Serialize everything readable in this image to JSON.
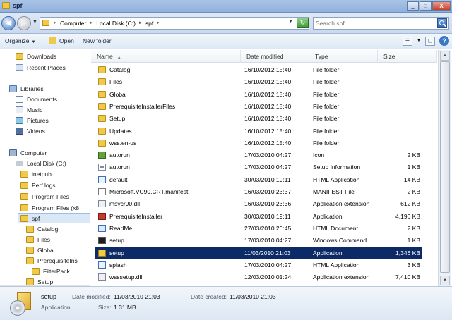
{
  "window": {
    "title": "spf"
  },
  "window_controls": {
    "minimize": "_",
    "maximize": "□",
    "close": "X"
  },
  "address": {
    "crumbs": [
      "Computer",
      "Local Disk (C:)",
      "spf"
    ],
    "search_placeholder": "Search spf"
  },
  "toolbar": {
    "organize": "Organize",
    "open": "Open",
    "new_folder": "New folder"
  },
  "nav": {
    "favorites": [
      {
        "label": "Downloads",
        "icon": "downloads-icon"
      },
      {
        "label": "Recent Places",
        "icon": "recent-places-icon"
      }
    ],
    "libraries_label": "Libraries",
    "libraries": [
      {
        "label": "Documents",
        "icon": "documents-icon"
      },
      {
        "label": "Music",
        "icon": "music-icon"
      },
      {
        "label": "Pictures",
        "icon": "pictures-icon"
      },
      {
        "label": "Videos",
        "icon": "videos-icon"
      }
    ],
    "computer_label": "Computer",
    "disk_label": "Local Disk (C:)",
    "disk_children": [
      "inetpub",
      "Perf.logs",
      "Program Files",
      "Program Files (x8"
    ],
    "selected": "spf",
    "spf_children": [
      "Catalog",
      "Files",
      "Global",
      "PrerequisiteIns"
    ],
    "filterpack": "FilterPack",
    "setup": "Setup"
  },
  "columns": {
    "name": "Name",
    "date": "Date modified",
    "type": "Type",
    "size": "Size"
  },
  "files": [
    {
      "name": "Catalog",
      "date": "16/10/2012 15:40",
      "type": "File folder",
      "size": "",
      "icon": "folder"
    },
    {
      "name": "Files",
      "date": "16/10/2012 15:40",
      "type": "File folder",
      "size": "",
      "icon": "folder"
    },
    {
      "name": "Global",
      "date": "16/10/2012 15:40",
      "type": "File folder",
      "size": "",
      "icon": "folder"
    },
    {
      "name": "PrerequisiteInstallerFiles",
      "date": "16/10/2012 15:40",
      "type": "File folder",
      "size": "",
      "icon": "folder"
    },
    {
      "name": "Setup",
      "date": "16/10/2012 15:40",
      "type": "File folder",
      "size": "",
      "icon": "folder"
    },
    {
      "name": "Updates",
      "date": "16/10/2012 15:40",
      "type": "File folder",
      "size": "",
      "icon": "folder"
    },
    {
      "name": "wss.en-us",
      "date": "16/10/2012 15:40",
      "type": "File folder",
      "size": "",
      "icon": "folder"
    },
    {
      "name": "autorun",
      "date": "17/03/2010 04:27",
      "type": "Icon",
      "size": "2 KB",
      "icon": "icon"
    },
    {
      "name": "autorun",
      "date": "17/03/2010 04:27",
      "type": "Setup Information",
      "size": "1 KB",
      "icon": "setupinfo"
    },
    {
      "name": "default",
      "date": "30/03/2010 19:11",
      "type": "HTML Application",
      "size": "14 KB",
      "icon": "html"
    },
    {
      "name": "Microsoft.VC90.CRT.manifest",
      "date": "16/03/2010 23:37",
      "type": "MANIFEST File",
      "size": "2 KB",
      "icon": "manifest"
    },
    {
      "name": "msvcr90.dll",
      "date": "16/03/2010 23:36",
      "type": "Application extension",
      "size": "612 KB",
      "icon": "dll"
    },
    {
      "name": "PrerequisiteInstaller",
      "date": "30/03/2010 19:11",
      "type": "Application",
      "size": "4,196 KB",
      "icon": "appred"
    },
    {
      "name": "ReadMe",
      "date": "27/03/2010 20:45",
      "type": "HTML Document",
      "size": "2 KB",
      "icon": "readme"
    },
    {
      "name": "setup",
      "date": "17/03/2010 04:27",
      "type": "Windows Command ...",
      "size": "1 KB",
      "icon": "cmd"
    },
    {
      "name": "setup",
      "date": "11/03/2010 21:03",
      "type": "Application",
      "size": "1,346 KB",
      "icon": "setupbox",
      "selected": true
    },
    {
      "name": "splash",
      "date": "17/03/2010 04:27",
      "type": "HTML Application",
      "size": "3 KB",
      "icon": "html"
    },
    {
      "name": "wsssetup.dll",
      "date": "12/03/2010 01:24",
      "type": "Application extension",
      "size": "7,410 KB",
      "icon": "dll"
    }
  ],
  "details": {
    "name": "setup",
    "type": "Application",
    "date_modified_label": "Date modified:",
    "date_modified": "11/03/2010 21:03",
    "date_created_label": "Date created:",
    "date_created": "11/03/2010 21:03",
    "size_label": "Size:",
    "size": "1.31 MB"
  },
  "colors": {
    "selection": "#0b2a66",
    "folder": "#f0c94a",
    "titlebar": "#a9c4e6"
  }
}
